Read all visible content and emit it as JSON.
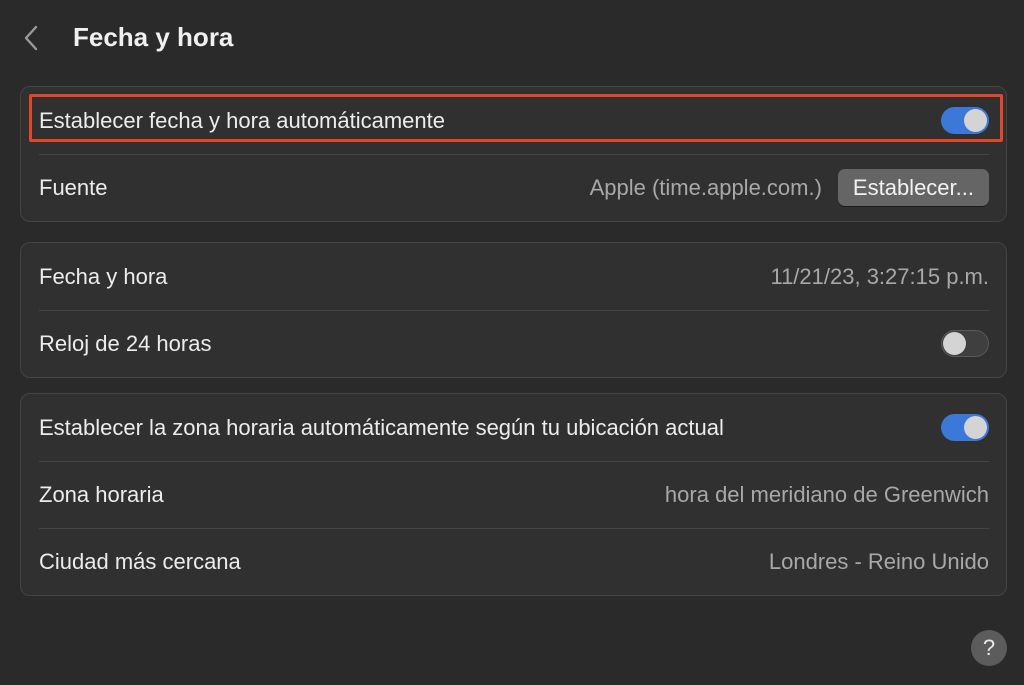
{
  "header": {
    "title": "Fecha y hora",
    "back_icon": "chevron-left-icon"
  },
  "group1": {
    "auto_datetime": {
      "label": "Establecer fecha y hora automáticamente",
      "toggle": true
    },
    "source": {
      "label": "Fuente",
      "value": "Apple (time.apple.com.)",
      "button_label": "Establecer..."
    }
  },
  "group2": {
    "datetime": {
      "label": "Fecha y hora",
      "value": "11/21/23, 3:27:15 p.m."
    },
    "clock24": {
      "label": "Reloj de 24 horas",
      "toggle": false
    }
  },
  "group3": {
    "auto_timezone": {
      "label": "Establecer la zona horaria automáticamente según tu ubicación actual",
      "toggle": true
    },
    "timezone": {
      "label": "Zona horaria",
      "value": "hora del meridiano de Greenwich"
    },
    "closest_city": {
      "label": "Ciudad más cercana",
      "value": "Londres - Reino Unido"
    }
  },
  "help": {
    "label": "?"
  },
  "colors": {
    "accent": "#3b78d8",
    "highlight": "#e0462a",
    "background": "#2a2a2a"
  }
}
